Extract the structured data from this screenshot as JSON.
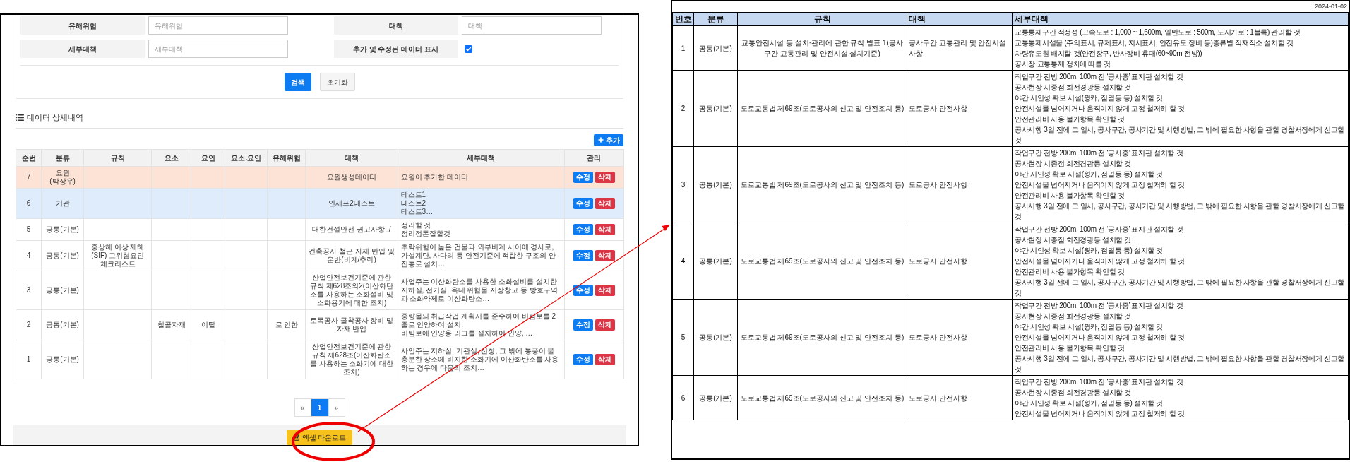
{
  "filter_form": {
    "fields": [
      {
        "kind": "text",
        "label": "유해위험",
        "placeholder": "유해위험"
      },
      {
        "kind": "text",
        "label": "대책",
        "placeholder": "대책"
      },
      {
        "kind": "text",
        "label": "세부대책",
        "placeholder": "세부대책"
      },
      {
        "kind": "checkbox",
        "label": "추가 및 수정된 데이터 표시",
        "checked": true
      }
    ],
    "buttons": [
      {
        "kind": "primary",
        "label": "검색"
      },
      {
        "kind": "secondary",
        "label": "초기화"
      }
    ]
  },
  "detail_section": {
    "title": "데이터 상세내역",
    "add_button": "추가",
    "table": {
      "columns": [
        "순번",
        "분류",
        "규칙",
        "요소",
        "요인",
        "요소.요인",
        "유해위험",
        "대책",
        "세부대책",
        "관리"
      ],
      "rows": [
        {
          "color": "#fde3d6",
          "no": "7",
          "category": "요원\n(박상우)",
          "measure": "요원생성데이터",
          "detail": "요원이 추가한 데이터",
          "actions": [
            {
              "kind": "edit",
              "label": "수정"
            },
            {
              "kind": "delete",
              "label": "삭제"
            }
          ]
        },
        {
          "color": "#deecfb",
          "no": "6",
          "category": "기관",
          "measure": "인세프2테스트",
          "detail": "테스트1\n테스트2\n테스트3…",
          "actions": [
            {
              "kind": "edit",
              "label": "수정"
            },
            {
              "kind": "delete",
              "label": "삭제"
            }
          ]
        },
        {
          "color": "#ffffff",
          "no": "5",
          "category": "공통(기본)",
          "measure": "대한건설안전 권고사항../",
          "detail": "정리할 것\n정리정돈잘할것",
          "actions": [
            {
              "kind": "edit",
              "label": "수정"
            },
            {
              "kind": "delete",
              "label": "삭제"
            }
          ]
        },
        {
          "color": "#ffffff",
          "no": "4",
          "category": "공통(기본)",
          "rule": "중상해 이상 재해(SIF) 고위험요인 체크리스트",
          "measure": "건축공사 철근 자재 반입 및 운반(비계/추락)",
          "detail": "추락위험이 높은 건물과 외부비계 사이에 경사로, 가설계단, 사다리 등 안전기준에 적합한 구조의 안전통로 설치…",
          "actions": [
            {
              "kind": "edit",
              "label": "수정"
            },
            {
              "kind": "delete",
              "label": "삭제"
            }
          ]
        },
        {
          "color": "#ffffff",
          "no": "3",
          "category": "공통(기본)",
          "measure": "산업안전보건기준에 관한 규칙 제628조의2(이산화탄소를 사용하는 소화설비 및 소화용기에 대한 조치)",
          "detail": "사업주는 이산화탄소를 사용한 소화설비를 설치한 지하실, 전기실, 옥내 위험물 저장창고 등 방호구역과 소화약제로 이산화탄소…",
          "actions": [
            {
              "kind": "edit",
              "label": "수정"
            },
            {
              "kind": "delete",
              "label": "삭제"
            }
          ]
        },
        {
          "color": "#ffffff",
          "no": "2",
          "category": "공통(기본)",
          "element": "철골자재",
          "factor": "이탈",
          "hazard": "로 인한",
          "measure": "토목공사 굴착공사 장비 및 자재 반입",
          "detail": "중량물의 취급작업 계획서를 준수하여 버팀보를 2줄로 인양하여 설치.\n버팀보에 인양용 러그를 설치하여 인양, …",
          "actions": [
            {
              "kind": "edit",
              "label": "수정"
            },
            {
              "kind": "delete",
              "label": "삭제"
            }
          ]
        },
        {
          "color": "#ffffff",
          "no": "1",
          "category": "공통(기본)",
          "measure": "산업안전보건기준에 관한 규칙 제628조(이산화탄소를 사용하는 소화기에 대한 조치)",
          "detail": "사업주는 지하실, 기관실, 선창, 그 밖에 통풍이 불충분한 장소에 비치한 소화기에 이산화탄소를 사용하는 경우에 다음의 조치…",
          "actions": [
            {
              "kind": "edit",
              "label": "수정"
            },
            {
              "kind": "delete",
              "label": "삭제"
            }
          ]
        }
      ]
    }
  },
  "pagination": {
    "prev": "«",
    "pages": [
      {
        "label": "1",
        "selected": true
      }
    ],
    "next": "»"
  },
  "download_button": "엑셀 다운로드",
  "export_sheet": {
    "date": "2024-01-02",
    "columns": [
      "번호",
      "분류",
      "규칙",
      "대책",
      "세부대책"
    ],
    "rows": [
      {
        "no": "1",
        "category": "공통(기본)",
        "rule": "교통안전시설 등 설치·관리에 관한 규칙 별표 1(공사구간 교통관리 및 안전시설 설치기준)",
        "measure": "공사구간 교통관리 및 안전시설 사항",
        "details": [
          "교통통제구간 적정성 (고속도로 : 1,000 ~ 1,600m, 일반도로 : 500m, 도시가로 : 1블록) 관리할 것",
          "교통통제시설물 (주의표시, 규제표시, 지시표시, 안전유도 장비 등)종류별 적재적소 설치할 것",
          "차량유도원 배치할 것(안전장구, 반사장비 휴대(60~90m 전방))",
          "공사장 교통통제 정차에 따를 것"
        ]
      },
      {
        "no": "2",
        "category": "공통(기본)",
        "rule": "도로교통법 제69조(도로공사의 신고 및 안전조치 등)",
        "measure": "도로공사 안전사항",
        "details": [
          "작업구간 전방 200m, 100m 전 ‘공사중’ 표지판 설치할 것",
          "공사현장 시종점 회전경광등 설치할 것",
          "야간 시인성 확보 시설(윙카, 점멸등 등) 설치할 것",
          "안전시설물 넘어지거나 움직이지 않게 고정 철저히 할 것",
          "안전관리비 사용 불가항목 확인할 것",
          "공사시행 3일 전에 그 일시, 공사구간, 공사기간 및 시행방법, 그 밖에 필요한 사항을 관할 경찰서장에게 신고할 것"
        ]
      },
      {
        "no": "3",
        "category": "공통(기본)",
        "rule": "도로교통법 제69조(도로공사의 신고 및 안전조치 등)",
        "measure": "도로공사 안전사항",
        "details": [
          "작업구간 전방 200m, 100m 전 ‘공사중’ 표지판 설치할 것",
          "공사현장 시종점 회전경광등 설치할 것",
          "야간 시인성 확보 시설(윙카, 점멸등 등) 설치할 것",
          "안전시설물 넘어지거나 움직이지 않게 고정 철저히 할 것",
          "안전관리비 사용 불가항목 확인할 것",
          "공사시행 3일 전에 그 일시, 공사구간, 공사기간 및 시행방법, 그 밖에 필요한 사항을 관할 경찰서장에게 신고할 것"
        ]
      },
      {
        "no": "4",
        "category": "공통(기본)",
        "rule": "도로교통법 제69조(도로공사의 신고 및 안전조치 등)",
        "measure": "도로공사 안전사항",
        "details": [
          "작업구간 전방 200m, 100m 전 ‘공사중’ 표지판 설치할 것",
          "공사현장 시종점 회전경광등 설치할 것",
          "야간 시인성 확보 시설(윙카, 점멸등 등) 설치할 것",
          "안전시설물 넘어지거나 움직이지 않게 고정 철저히 할 것",
          "안전관리비 사용 불가항목 확인할 것",
          "공사시행 3일 전에 그 일시, 공사구간, 공사기간 및 시행방법, 그 밖에 필요한 사항을 관할 경찰서장에게 신고할 것"
        ]
      },
      {
        "no": "5",
        "category": "공통(기본)",
        "rule": "도로교통법 제69조(도로공사의 신고 및 안전조치 등)",
        "measure": "도로공사 안전사항",
        "details": [
          "작업구간 전방 200m, 100m 전 ‘공사중’ 표지판 설치할 것",
          "공사현장 시종점 회전경광등 설치할 것",
          "야간 시인성 확보 시설(윙카, 점멸등 등) 설치할 것",
          "안전시설물 넘어지거나 움직이지 않게 고정 철저히 할 것",
          "안전관리비 사용 불가항목 확인할 것",
          "공사시행 3일 전에 그 일시, 공사구간, 공사기간 및 시행방법, 그 밖에 필요한 사항을 관할 경찰서장에게 신고할 것"
        ]
      },
      {
        "no": "6",
        "category": "공통(기본)",
        "rule": "도로교통법 제69조(도로공사의 신고 및 안전조치 등)",
        "measure": "도로공사 안전사항",
        "details": [
          "작업구간 전방 200m, 100m 전 ‘공사중’ 표지판 설치할 것",
          "공사현장 시종점 회전경광등 설치할 것",
          "야간 시인성 확보 시설(윙카, 점멸등 등) 설치할 것",
          "안전시설물 넘어지거나 움직이지 않게 고정 철저히 할 것"
        ]
      }
    ]
  }
}
